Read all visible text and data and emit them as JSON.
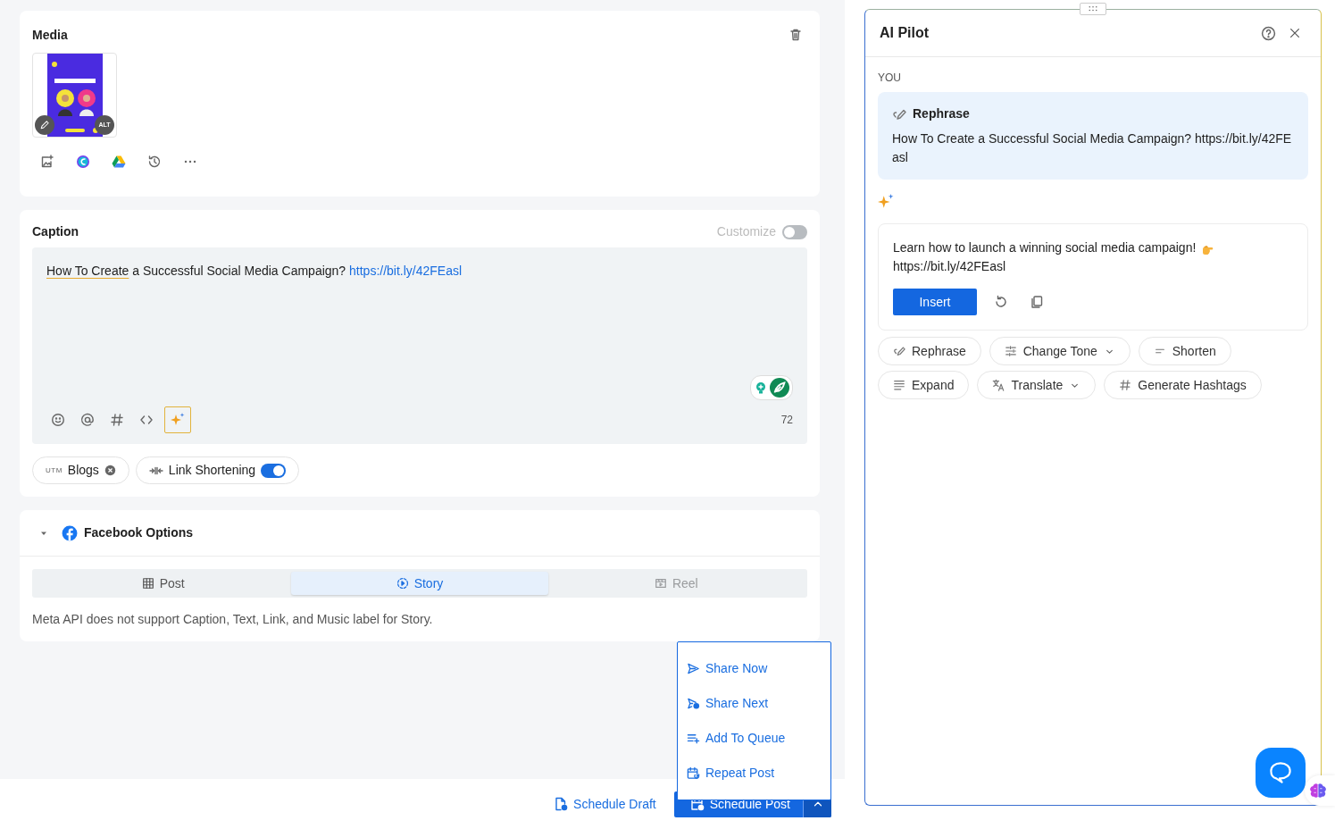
{
  "media": {
    "title": "Media",
    "alt_label": "ALT"
  },
  "caption": {
    "title": "Caption",
    "customize_label": "Customize",
    "customize_on": false,
    "text_marked": "How To Create",
    "text": " a Successful Social Media Campaign? ",
    "link": "https://bit.ly/42FEasl",
    "char_count": "72"
  },
  "chips": [
    {
      "kind": "utm",
      "prefix": "UTM",
      "label": "Blogs"
    },
    {
      "kind": "toggle",
      "label": "Link Shortening",
      "on": true
    }
  ],
  "facebook": {
    "title": "Facebook Options",
    "expanded": true,
    "tabs": [
      {
        "label": "Post",
        "selected": false,
        "disabled": false
      },
      {
        "label": "Story",
        "selected": true,
        "disabled": false
      },
      {
        "label": "Reel",
        "selected": false,
        "disabled": true
      }
    ],
    "note": "Meta API does not support Caption, Text, Link, and Music label for Story."
  },
  "menu": [
    {
      "label": "Share Now"
    },
    {
      "label": "Share Next"
    },
    {
      "label": "Add To Queue"
    },
    {
      "label": "Repeat Post"
    }
  ],
  "footer": {
    "draft_label": "Schedule Draft",
    "post_label": "Schedule Post",
    "menu_open": true
  },
  "ai": {
    "title": "AI Pilot",
    "you_label": "YOU",
    "request": {
      "action": "Rephrase",
      "text": "How To Create a Successful Social Media Campaign? https://bit.ly/42FEasl"
    },
    "response": "Learn how to launch a winning social media campaign!",
    "response_link": "https://bit.ly/42FEasl",
    "insert_label": "Insert",
    "actions": [
      {
        "label": "Rephrase",
        "dropdown": false
      },
      {
        "label": "Change Tone",
        "dropdown": true
      },
      {
        "label": "Shorten",
        "dropdown": false
      },
      {
        "label": "Expand",
        "dropdown": false
      },
      {
        "label": "Translate",
        "dropdown": true
      },
      {
        "label": "Generate Hashtags",
        "dropdown": false
      }
    ]
  }
}
